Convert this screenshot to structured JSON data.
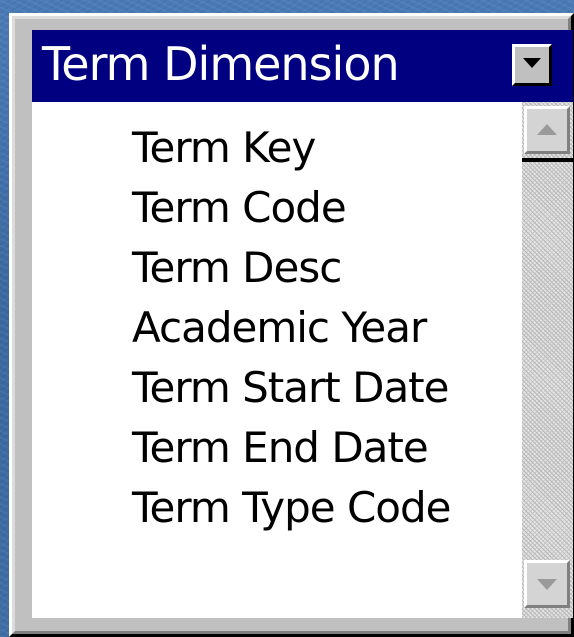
{
  "header": {
    "title": "Term Dimension",
    "dropdown_icon": "dropdown-arrow-icon"
  },
  "list": {
    "items": [
      "Term Key",
      "Term Code",
      "Term Desc",
      "Academic Year",
      "Term Start Date",
      "Term End Date",
      "Term Type Code"
    ]
  },
  "scrollbar": {
    "up_icon": "scroll-up-arrow-icon",
    "down_icon": "scroll-down-arrow-icon"
  },
  "colors": {
    "header_background": "#000080",
    "header_text": "#ffffff",
    "list_background": "#ffffff",
    "list_text": "#000000",
    "window_chrome": "#c0c0c0",
    "desktop_background": "#3f6ea6"
  }
}
